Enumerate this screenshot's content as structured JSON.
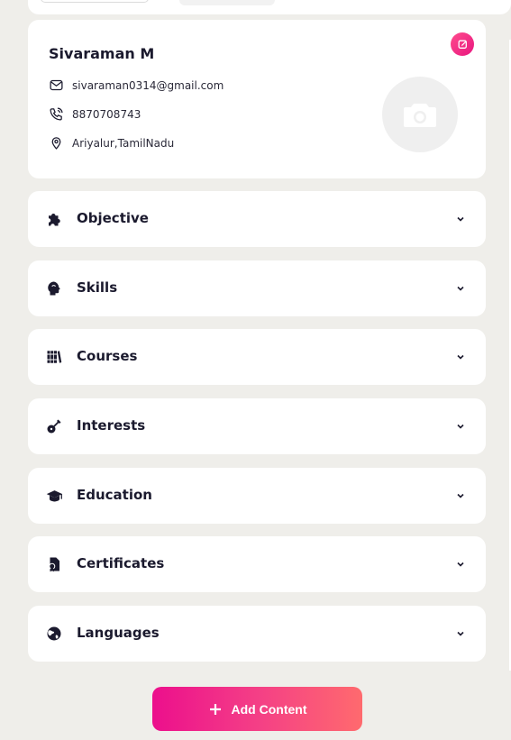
{
  "profile": {
    "name": "Sivaraman M",
    "email": "sivaraman0314@gmail.com",
    "phone": "8870708743",
    "location": "Ariyalur,TamilNadu"
  },
  "sections": [
    {
      "label": "Objective",
      "icon": "puzzle-icon"
    },
    {
      "label": "Skills",
      "icon": "brain-head-icon"
    },
    {
      "label": "Courses",
      "icon": "books-icon"
    },
    {
      "label": "Interests",
      "icon": "guitar-icon"
    },
    {
      "label": "Education",
      "icon": "graduation-cap-icon"
    },
    {
      "label": "Certificates",
      "icon": "certificate-icon"
    },
    {
      "label": "Languages",
      "icon": "globe-icon"
    }
  ],
  "add_button": {
    "label": "Add Content"
  },
  "colors": {
    "accent_start": "#ec0f8c",
    "accent_end": "#ff6a6e",
    "background": "#efeeea",
    "card": "#ffffff",
    "text": "#1b1a2e"
  }
}
